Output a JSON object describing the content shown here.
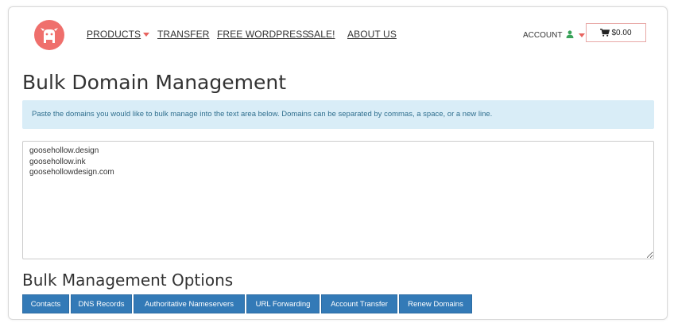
{
  "colors": {
    "brand": "#ef6f6c",
    "primary_button": "#337ab7",
    "info_background": "#d9edf7",
    "info_text": "#31708f",
    "account_icon": "#3aa35a"
  },
  "logo": {
    "icon": "goose-logo-icon"
  },
  "nav": {
    "items": [
      {
        "label": "PRODUCTS"
      },
      {
        "label": "TRANSFER"
      },
      {
        "label": "FREE WORDPRESS"
      },
      {
        "label": "SALE!"
      },
      {
        "label": "ABOUT US"
      }
    ]
  },
  "account": {
    "label": "ACCOUNT"
  },
  "cart": {
    "total": "$0.00"
  },
  "page": {
    "title": "Bulk Domain Management",
    "info": "Paste the domains you would like to bulk manage into the text area below. Domains can be separated by commas, a space, or a new line.",
    "domains_value": "goosehollow.design\ngoosehollow.ink\ngoosehollowdesign.com"
  },
  "options": {
    "title": "Bulk Management Options",
    "buttons": [
      {
        "label": "Contacts"
      },
      {
        "label": "DNS Records"
      },
      {
        "label": "Authoritative Nameservers"
      },
      {
        "label": "URL Forwarding"
      },
      {
        "label": "Account Transfer"
      },
      {
        "label": "Renew Domains"
      }
    ]
  }
}
